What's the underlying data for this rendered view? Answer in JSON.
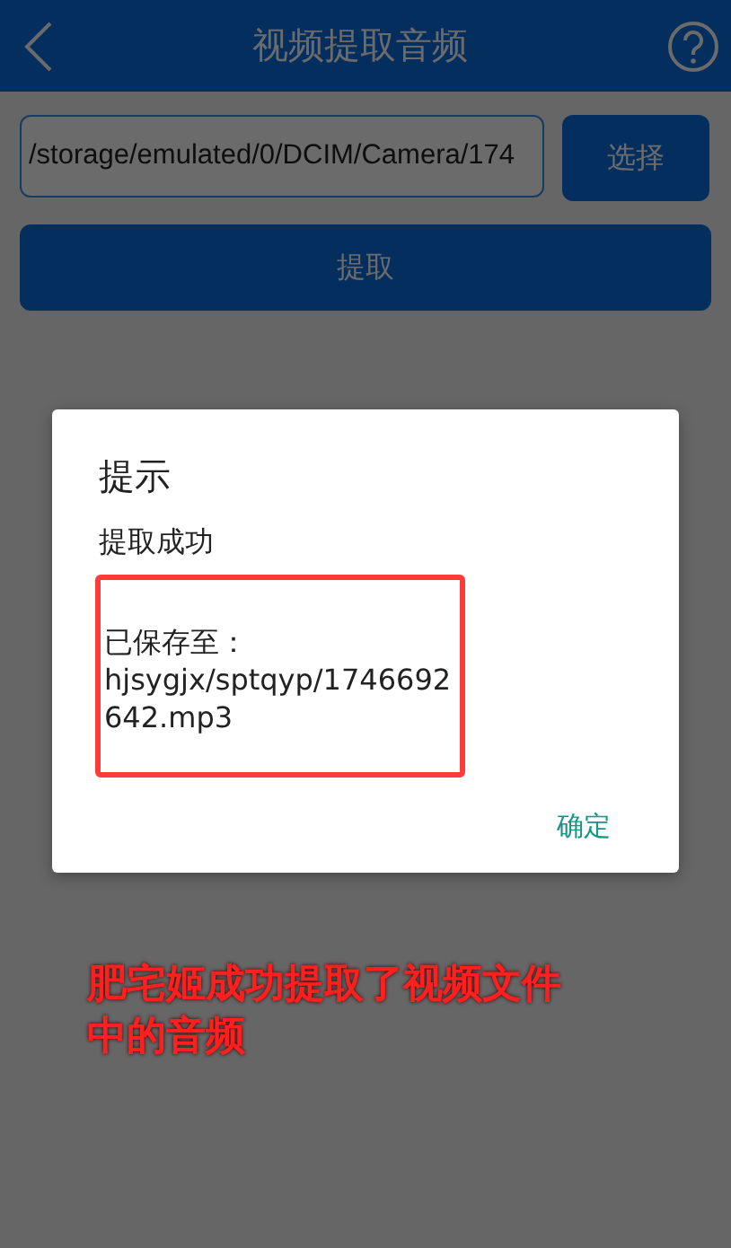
{
  "header": {
    "title": "视频提取音频"
  },
  "file_field": {
    "value": "/storage/emulated/0/DCIM/Camera/174"
  },
  "buttons": [
    "选择",
    "提取"
  ],
  "dialog": {
    "title": "提示",
    "message": "提取成功",
    "saved_path": "已保存至：hjsygjx/sptqyp/1746692642.mp3",
    "confirm": "确定"
  },
  "annotation": "肥宅姬成功提取了视频文件中的音频"
}
